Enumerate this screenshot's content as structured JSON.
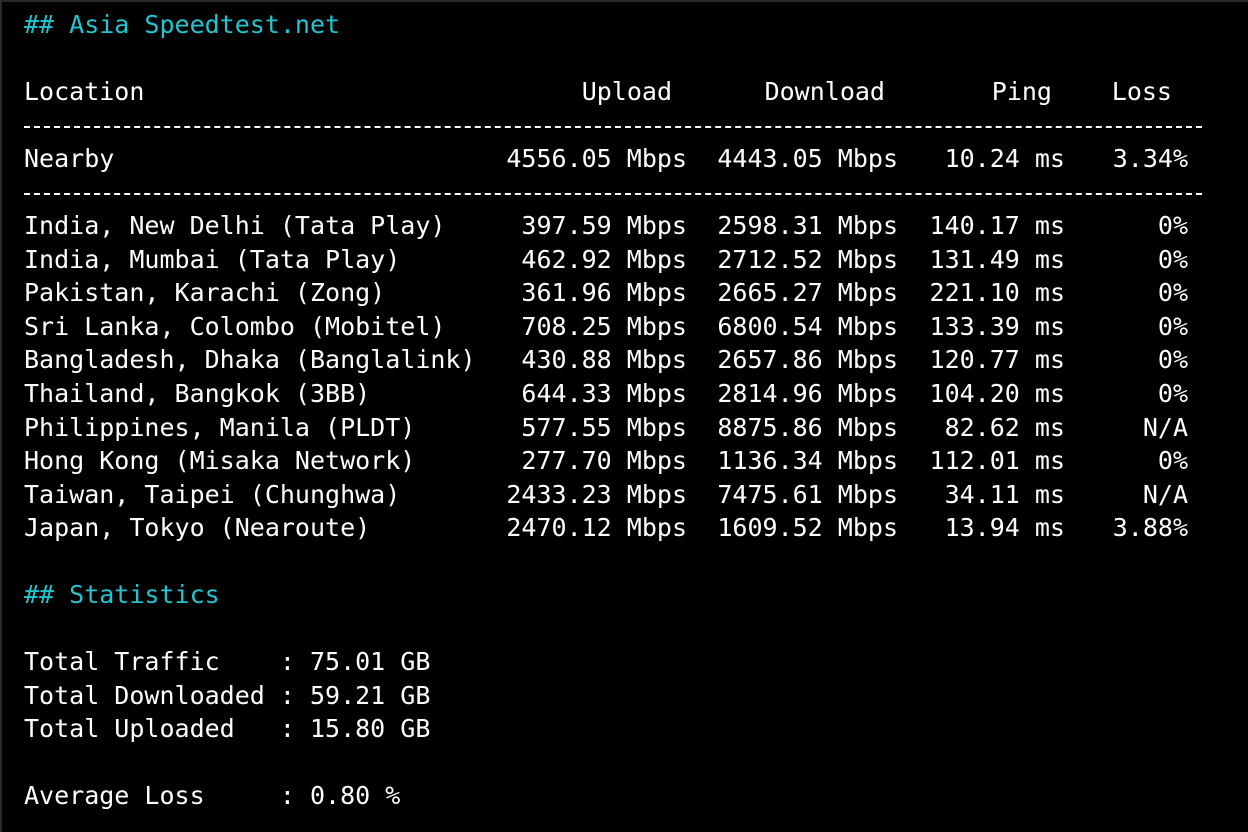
{
  "colors": {
    "background": "#000000",
    "text": "#ffffff",
    "heading": "#22c4d0"
  },
  "asia_heading": "## Asia Speedtest.net",
  "table": {
    "headers": {
      "location": "Location",
      "upload": "Upload",
      "download": "Download",
      "ping": "Ping",
      "loss": "Loss"
    },
    "nearby": {
      "location": "Nearby",
      "upload": "4556.05 Mbps",
      "download": "4443.05 Mbps",
      "ping": "10.24 ms",
      "loss": "3.34%"
    },
    "rows": [
      {
        "location": "India, New Delhi (Tata Play)",
        "upload": "397.59 Mbps",
        "download": "2598.31 Mbps",
        "ping": "140.17 ms",
        "loss": "0%"
      },
      {
        "location": "India, Mumbai (Tata Play)",
        "upload": "462.92 Mbps",
        "download": "2712.52 Mbps",
        "ping": "131.49 ms",
        "loss": "0%"
      },
      {
        "location": "Pakistan, Karachi (Zong)",
        "upload": "361.96 Mbps",
        "download": "2665.27 Mbps",
        "ping": "221.10 ms",
        "loss": "0%"
      },
      {
        "location": "Sri Lanka, Colombo (Mobitel)",
        "upload": "708.25 Mbps",
        "download": "6800.54 Mbps",
        "ping": "133.39 ms",
        "loss": "0%"
      },
      {
        "location": "Bangladesh, Dhaka (Banglalink)",
        "upload": "430.88 Mbps",
        "download": "2657.86 Mbps",
        "ping": "120.77 ms",
        "loss": "0%"
      },
      {
        "location": "Thailand, Bangkok (3BB)",
        "upload": "644.33 Mbps",
        "download": "2814.96 Mbps",
        "ping": "104.20 ms",
        "loss": "0%"
      },
      {
        "location": "Philippines, Manila (PLDT)",
        "upload": "577.55 Mbps",
        "download": "8875.86 Mbps",
        "ping": "82.62 ms",
        "loss": "N/A"
      },
      {
        "location": "Hong Kong (Misaka Network)",
        "upload": "277.70 Mbps",
        "download": "1136.34 Mbps",
        "ping": "112.01 ms",
        "loss": "0%"
      },
      {
        "location": "Taiwan, Taipei (Chunghwa)",
        "upload": "2433.23 Mbps",
        "download": "7475.61 Mbps",
        "ping": "34.11 ms",
        "loss": "N/A"
      },
      {
        "location": "Japan, Tokyo (Nearoute)",
        "upload": "2470.12 Mbps",
        "download": "1609.52 Mbps",
        "ping": "13.94 ms",
        "loss": "3.88%"
      }
    ]
  },
  "statistics_heading": "## Statistics",
  "statistics": {
    "total_traffic": "Total Traffic    : 75.01 GB",
    "total_downloaded": "Total Downloaded : 59.21 GB",
    "total_uploaded": "Total Uploaded   : 15.80 GB",
    "average_loss": "Average Loss     : 0.80 %"
  }
}
